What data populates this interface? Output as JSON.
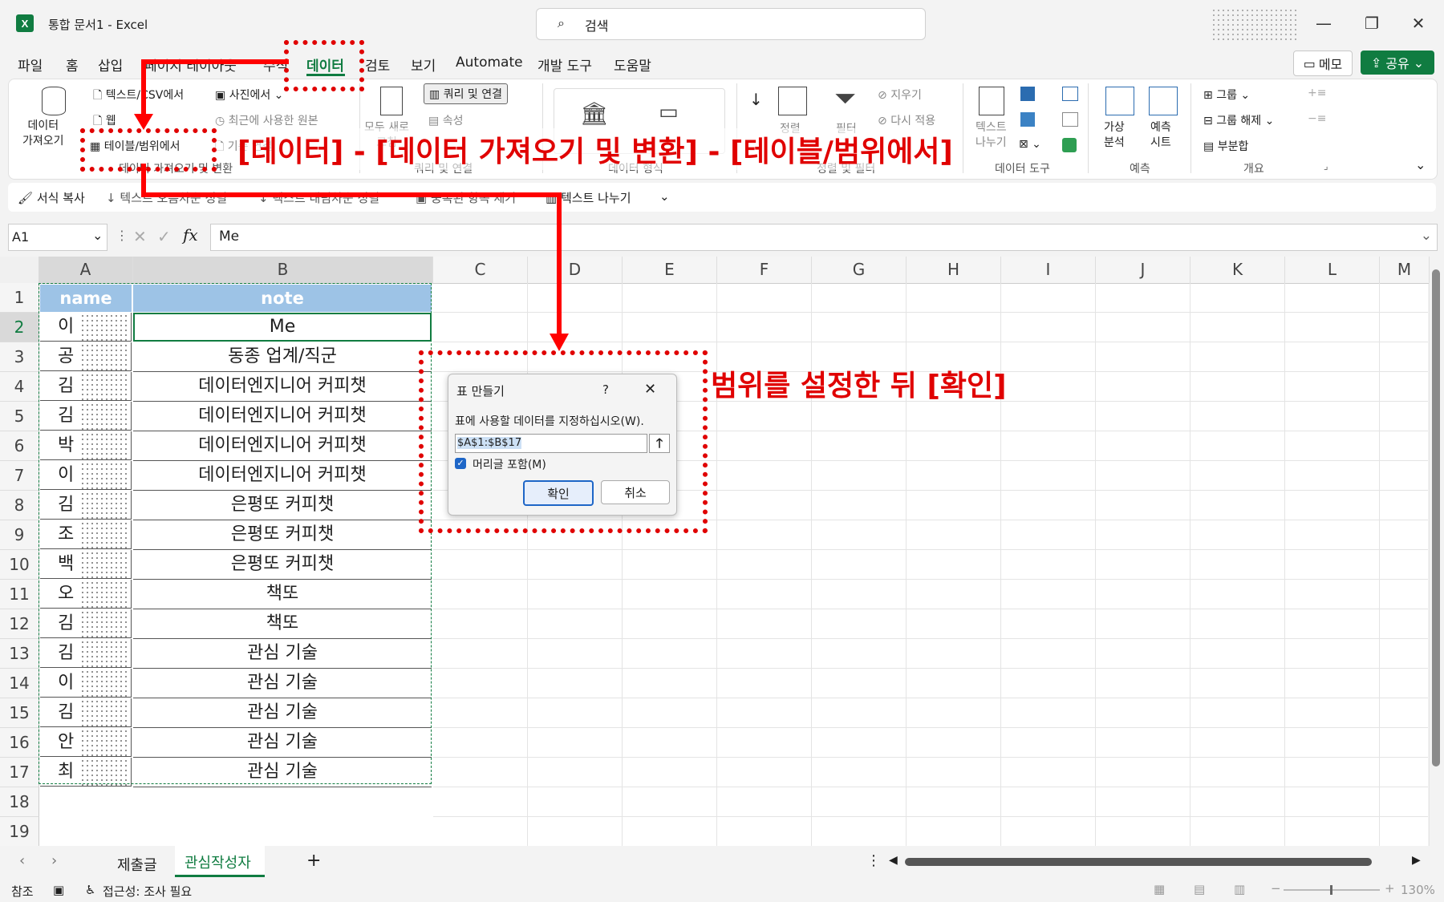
{
  "window": {
    "title": "통합 문서1  -  Excel",
    "app_icon": "X",
    "search_placeholder": "검색",
    "minimize": "—",
    "maximize": "❐",
    "close": "✕"
  },
  "menu": {
    "items": [
      "파일",
      "홈",
      "삽입",
      "페이지 레이아웃",
      "수식",
      "데이터",
      "검토",
      "보기",
      "Automate",
      "개발 도구",
      "도움말"
    ],
    "memo": "메모",
    "share": "공유"
  },
  "ribbon": {
    "get_data": "데이터\n가져오기",
    "text_csv": "텍스트/CSV에서",
    "web": "웹",
    "from_table": "테이블/범위에서",
    "from_picture": "사진에서",
    "recent_sources": "최근에 사용한 원본",
    "existing_conn": "기존 연결",
    "group_get_transform": "데이터 가져오기 및 변환",
    "refresh_all": "모두 새로\n고침",
    "queries_connections": "쿼리 및 연결",
    "properties": "속성",
    "group_queries": "쿼리 및 연결",
    "group_data_types": "데이터 형식",
    "sort": "정렬",
    "filter": "필터",
    "clear": "지우기",
    "reapply": "다시 적용",
    "group_sort_filter": "정렬 및 필터",
    "text_to_columns": "텍스트\n나누기",
    "group_data_tools": "데이터 도구",
    "what_if": "가상\n분석",
    "forecast_sheet": "예측\n시트",
    "group_forecast": "예측",
    "group": "그룹",
    "ungroup": "그룹 해제",
    "subtotal": "부분합",
    "group_outline": "개요"
  },
  "quickbar": {
    "format_painter": "서식 복사",
    "sort_asc": "텍스트 오름차순 정렬",
    "sort_desc": "텍스트 내림차순 정렬",
    "remove_dup": "중복된 항목 제거",
    "text_split": "텍스트 나누기"
  },
  "formula_bar": {
    "name_box": "A1",
    "fx": "fx",
    "value": "Me"
  },
  "columns": [
    "A",
    "B",
    "C",
    "D",
    "E",
    "F",
    "G",
    "H",
    "I",
    "J",
    "K",
    "L",
    "M"
  ],
  "rows": [
    "1",
    "2",
    "3",
    "4",
    "5",
    "6",
    "7",
    "8",
    "9",
    "10",
    "11",
    "12",
    "13",
    "14",
    "15",
    "16",
    "17",
    "18",
    "19"
  ],
  "table": {
    "headers": [
      "name",
      "note"
    ],
    "names": [
      "이",
      "공",
      "김",
      "김",
      "박",
      "이",
      "김",
      "조",
      "백",
      "오",
      "김",
      "김",
      "이",
      "김",
      "안",
      "최"
    ],
    "notes": [
      "Me",
      "동종 업계/직군",
      "데이터엔지니어 커피챗",
      "데이터엔지니어 커피챗",
      "데이터엔지니어 커피챗",
      "데이터엔지니어 커피챗",
      "은평또 커피챗",
      "은평또 커피챗",
      "은평또 커피챗",
      "책또",
      "책또",
      "관심 기술",
      "관심 기술",
      "관심 기술",
      "관심 기술",
      "관심 기술"
    ]
  },
  "dialog": {
    "title": "표 만들기",
    "help": "?",
    "close": "✕",
    "prompt": "표에 사용할 데이터를 지정하십시오(W).",
    "range": "$A$1:$B$17",
    "headers_checkbox": "머리글 포함(M)",
    "ok": "확인",
    "cancel": "취소"
  },
  "annotations": {
    "path": "[데이터] - [데이터 가져오기 및 변환] - [테이블/범위에서]",
    "instruction": "범위를 설정한 뒤 [확인]"
  },
  "sheets": {
    "tabs": [
      "제출글",
      "관심작성자"
    ],
    "active": "관심작성자",
    "add": "+"
  },
  "status": {
    "ready": "참조",
    "accessibility": "접근성: 조사 필요",
    "zoom": "130%"
  },
  "colors": {
    "excel_green": "#107c41",
    "annotation_red": "#e00000",
    "header_fill": "#9dc3e6"
  }
}
